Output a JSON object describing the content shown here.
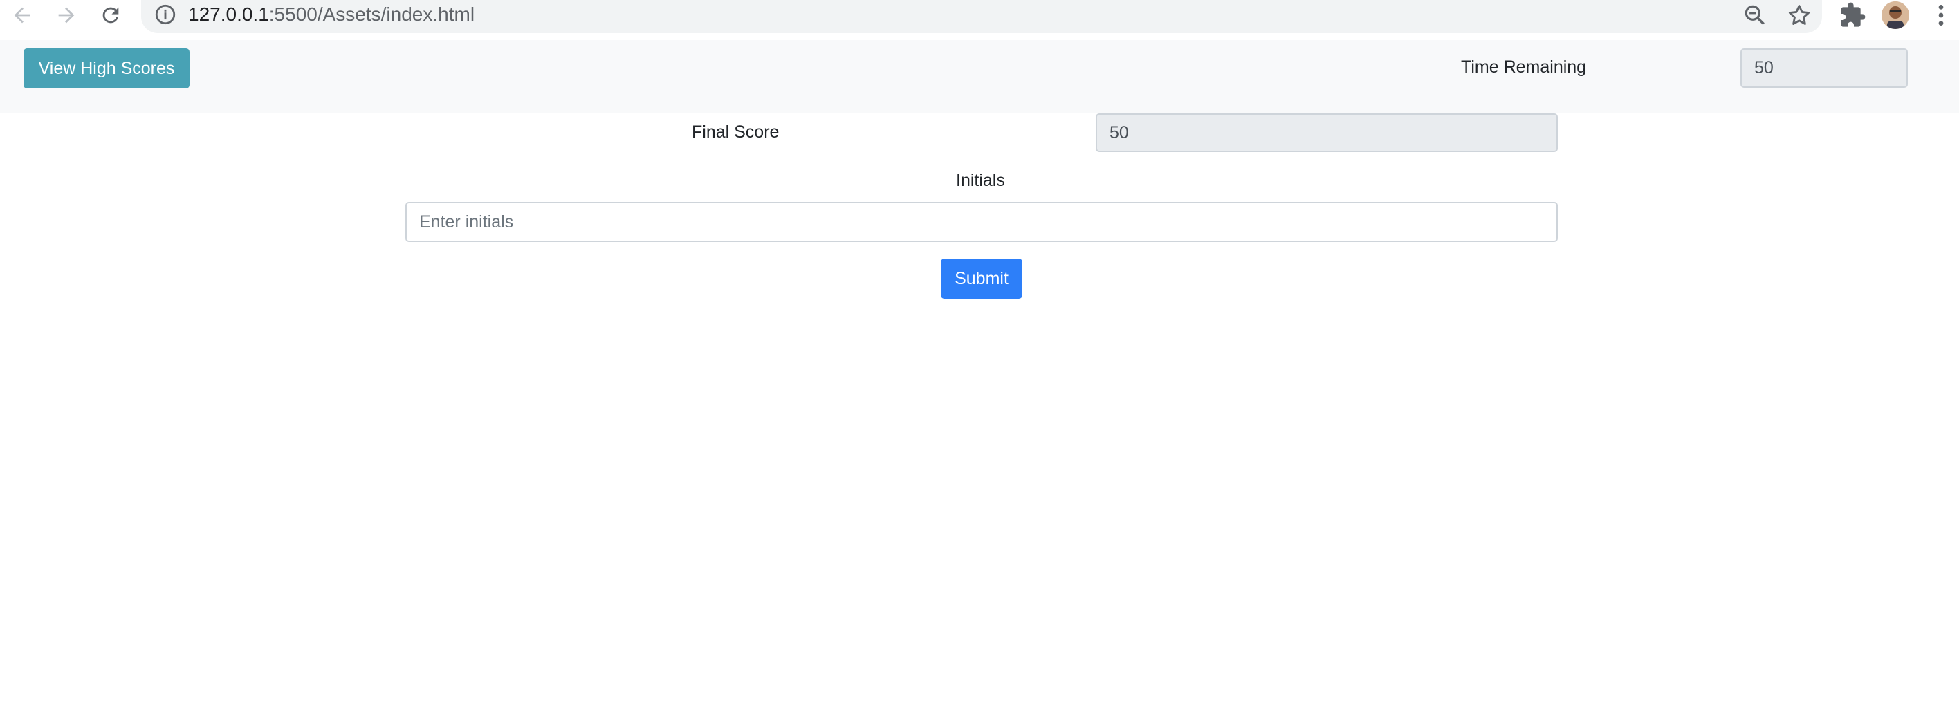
{
  "browser": {
    "url_host": "127.0.0.1",
    "url_path": ":5500/Assets/index.html",
    "icons": [
      "back-arrow-icon",
      "forward-arrow-icon",
      "reload-icon",
      "info-icon",
      "zoom-icon",
      "bookmark-star-icon",
      "extensions-icon",
      "avatar",
      "kebab-menu-icon"
    ]
  },
  "navbar": {
    "high_scores_label": "View High Scores",
    "time_label": "Time Remaining",
    "time_value": "50"
  },
  "form": {
    "final_score_label": "Final Score",
    "final_score_value": "50",
    "initials_label": "Initials",
    "initials_placeholder": "Enter initials",
    "initials_value": "",
    "submit_label": "Submit"
  },
  "colors": {
    "info_button": "#48a2b5",
    "primary_button": "#2d7ff9",
    "navbar_bg": "#f8f9fa",
    "readonly_bg": "#e9ecef"
  }
}
